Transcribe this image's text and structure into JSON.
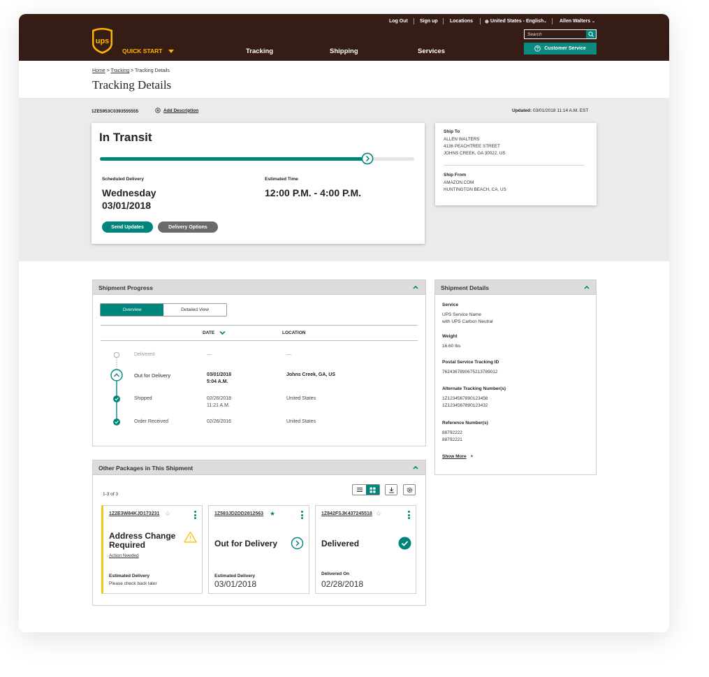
{
  "header": {
    "top_links": [
      "Log Out",
      "Sign up",
      "Locations"
    ],
    "locale": "United States - English",
    "user": "Allen Walters",
    "quick_start": "QUICK START",
    "nav": [
      "Tracking",
      "Shipping",
      "Services"
    ],
    "search_placeholder": "Search",
    "customer_service": "Customer Service",
    "logo_text": "ups"
  },
  "breadcrumb": {
    "home": "Home",
    "tracking": "Tracking",
    "current": "Tracking Details"
  },
  "page_title": "Tracking Details",
  "tracking_number": "1ZE5953C0393555555",
  "add_description": "Add Description",
  "updated": {
    "label": "Updated:",
    "value": "03/01/2018  11:14 A.M. EST"
  },
  "status": {
    "title": "In Transit",
    "progress": 0.85,
    "scheduled_label": "Scheduled Delivery",
    "scheduled_day": "Wednesday",
    "scheduled_date": "03/01/2018",
    "estimated_label": "Estimated Time",
    "estimated_value": "12:00 P.M. - 4:00 P.M.",
    "send_updates": "Send Updates",
    "delivery_options": "Delivery Options"
  },
  "ship_to": {
    "label": "Ship To",
    "lines": [
      "ALLEN WALTERS",
      "4136 PEACHTREE STREET",
      "JOHNS CREEK, GA 30022, US"
    ]
  },
  "ship_from": {
    "label": "Ship From",
    "lines": [
      "AMAZON.COM",
      "HUNTINGTON BEACH, CA, US"
    ]
  },
  "progress_panel": {
    "title": "Shipment Progress",
    "tabs": [
      "Overview",
      "Detailed View"
    ],
    "col_date": "DATE",
    "col_location": "LOCATION",
    "rows": [
      {
        "status": "Delivered",
        "date": "—",
        "time": "",
        "location": "—"
      },
      {
        "status": "Out for Delivery",
        "date": "03/01/2018",
        "time": "5:04 A.M.",
        "location": "Johns Creek, GA, US"
      },
      {
        "status": "Shipped",
        "date": "02/26/2018",
        "time": "11:21 A.M.",
        "location": "United States"
      },
      {
        "status": "Order Received",
        "date": "02/26/2016",
        "time": "",
        "location": "United States"
      }
    ]
  },
  "details_panel": {
    "title": "Shipment Details",
    "service_label": "Service",
    "service_lines": [
      "UPS Service Name",
      "with UPS Carbon Neutral"
    ],
    "weight_label": "Weight",
    "weight_value": "16.60 lbs",
    "postal_label": "Postal Service Tracking ID",
    "postal_value": "7624367890675213789012",
    "alt_label": "Alternate Tracking Number(s)",
    "alt_lines": [
      "1Z1234567890123456",
      "1Z1234567890123432"
    ],
    "ref_label": "Reference Number(s)",
    "ref_lines": [
      "88792222",
      "88792221"
    ],
    "show_more": "Show More",
    "plus": "+"
  },
  "packages_panel": {
    "title": "Other Packages in This Shipment",
    "count": "1-3 of 3",
    "packages": [
      {
        "number": "1Z2E3W84KJD173231",
        "status": "Address Change Required",
        "action": "Action Needed",
        "label": "Estimated Delivery",
        "value": "Please check back later"
      },
      {
        "number": "1Z583JD2DD2812563",
        "status": "Out for Delivery",
        "label": "Estimated Delivery",
        "value": "03/01/2018"
      },
      {
        "number": "1Z842FSJK437245518",
        "status": "Delivered",
        "label": "Delivered On",
        "value": "02/28/2018"
      }
    ]
  },
  "colors": {
    "brown": "#351c15",
    "gold": "#ffb500",
    "teal": "#00857d",
    "warning": "#f2c811"
  }
}
